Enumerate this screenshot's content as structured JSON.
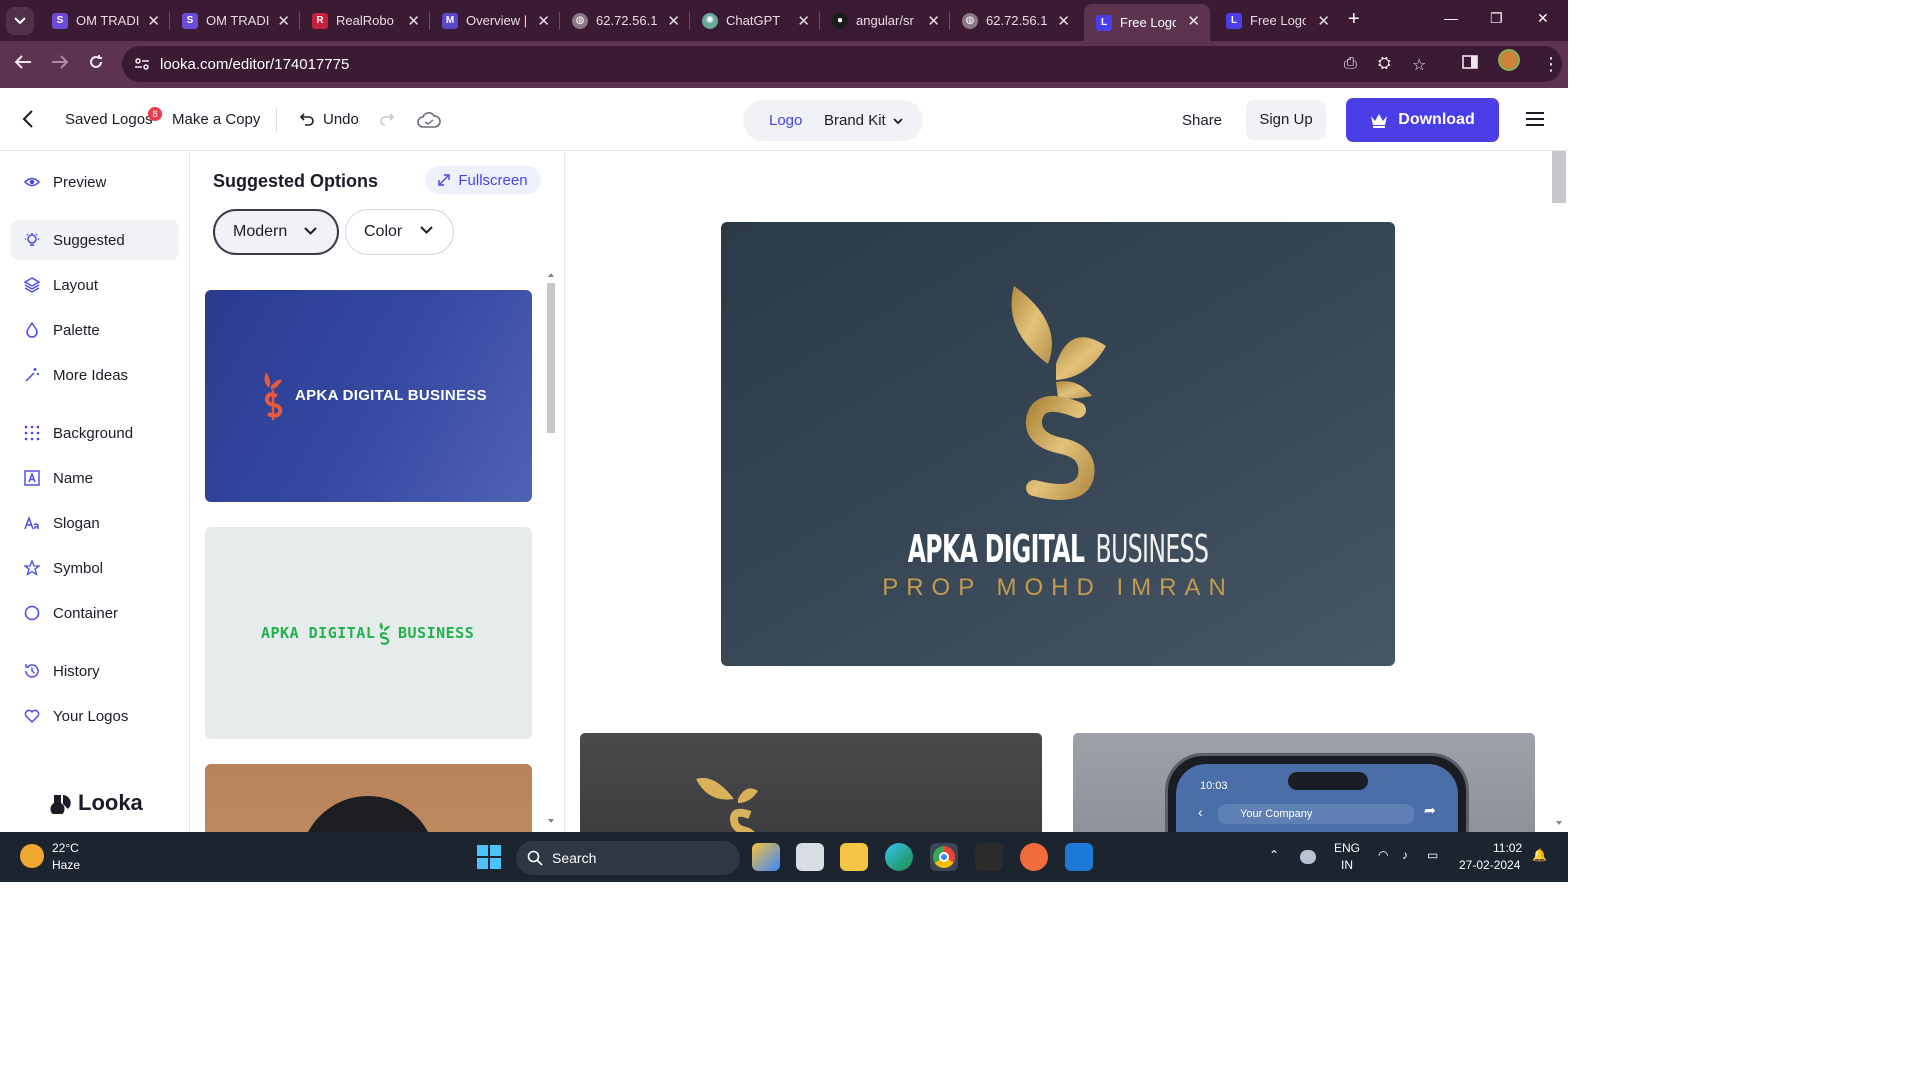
{
  "browser": {
    "tabs": [
      {
        "label": "OM TRADI",
        "favicon": "om-trade-icon"
      },
      {
        "label": "OM TRADI",
        "favicon": "om-trade-icon"
      },
      {
        "label": "RealRobo",
        "favicon": "realrobo-icon"
      },
      {
        "label": "Overview |",
        "favicon": "overview-icon"
      },
      {
        "label": "62.72.56.1",
        "favicon": "globe-icon"
      },
      {
        "label": "ChatGPT",
        "favicon": "chatgpt-icon"
      },
      {
        "label": "angular/sr",
        "favicon": "github-icon"
      },
      {
        "label": "62.72.56.1",
        "favicon": "globe-icon"
      },
      {
        "label": "Free Logo",
        "favicon": "looka-icon",
        "active": true
      },
      {
        "label": "Free Logo",
        "favicon": "looka-icon"
      }
    ],
    "url": "looka.com/editor/174017775"
  },
  "header": {
    "saved_logos": "Saved Logos",
    "saved_count": "8",
    "make_copy": "Make a Copy",
    "undo": "Undo",
    "seg_logo": "Logo",
    "seg_brand": "Brand Kit",
    "share": "Share",
    "signup": "Sign Up",
    "download": "Download"
  },
  "sidebar": {
    "items": [
      {
        "label": "Preview",
        "icon": "eye-icon"
      },
      {
        "label": "Suggested",
        "icon": "lightbulb-icon",
        "active": true
      },
      {
        "label": "Layout",
        "icon": "layers-icon"
      },
      {
        "label": "Palette",
        "icon": "drop-icon"
      },
      {
        "label": "More Ideas",
        "icon": "magic-wand-icon"
      },
      {
        "label": "Background",
        "icon": "grid-dots-icon"
      },
      {
        "label": "Name",
        "icon": "text-box-icon"
      },
      {
        "label": "Slogan",
        "icon": "text-a-icon"
      },
      {
        "label": "Symbol",
        "icon": "star-icon"
      },
      {
        "label": "Container",
        "icon": "circle-icon"
      },
      {
        "label": "History",
        "icon": "history-icon"
      },
      {
        "label": "Your Logos",
        "icon": "heart-icon"
      }
    ],
    "brand": "Looka"
  },
  "panel": {
    "title": "Suggested Options",
    "fullscreen": "Fullscreen",
    "filter_style": "Modern",
    "filter_color": "Color",
    "cards": [
      {
        "name": "APKA DIGITAL BUSINESS",
        "accent": "#e85a3c",
        "bg": "#364aa3"
      },
      {
        "name_left": "APKA DIGITAL",
        "name_right": "BUSINESS",
        "accent": "#22b14c",
        "bg": "#e6ecec"
      }
    ]
  },
  "preview": {
    "name_bold": "APKA DIGITAL",
    "name_thin": "BUSINESS",
    "slogan": "PROP MOHD IMRAN",
    "gold": "#c9a24f",
    "bg": "#364654",
    "phone_time": "10:03",
    "phone_search": "Your Company"
  },
  "taskbar": {
    "temp": "22°C",
    "weather": "Haze",
    "search": "Search",
    "lang1": "ENG",
    "lang2": "IN",
    "time": "11:02",
    "date": "27-02-2024"
  }
}
